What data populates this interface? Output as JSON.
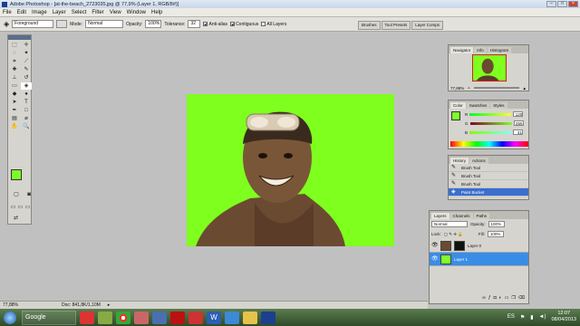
{
  "window": {
    "title": "Adobe Photoshop - [at-the-beach_2723035.jpg @ 77,9% (Layer 1, RGB/8#)]"
  },
  "menu": [
    "File",
    "Edit",
    "Image",
    "Layer",
    "Select",
    "Filter",
    "View",
    "Window",
    "Help"
  ],
  "options": {
    "preset": "Foreground",
    "mode_label": "Mode:",
    "mode_value": "Normal",
    "opacity_label": "Opacity:",
    "opacity_value": "100%",
    "tolerance_label": "Tolerance:",
    "tolerance_value": "32",
    "antialias": "Anti-alias",
    "contiguous": "Contiguous",
    "all_layers": "All Layers"
  },
  "panel_well": [
    "Brushes",
    "Tool Presets",
    "Layer Comps"
  ],
  "navigator": {
    "tabs": [
      "Navigator",
      "Info",
      "Histogram"
    ],
    "zoom": "77,88%"
  },
  "color": {
    "tabs": [
      "Color",
      "Swatches",
      "Styles"
    ],
    "foreground": "#7FFF2A",
    "channels": [
      {
        "label": "R",
        "value": "120",
        "gradient": "linear-gradient(90deg,#00ff2a,#ffff2a)"
      },
      {
        "label": "G",
        "value": "255",
        "gradient": "linear-gradient(90deg,#7f002a,#7fff2a)"
      },
      {
        "label": "B",
        "value": "41",
        "gradient": "linear-gradient(90deg,#7fff00,#7fffff)"
      }
    ]
  },
  "history": {
    "tabs": [
      "History",
      "Actions"
    ],
    "items": [
      {
        "label": "Brush Tool",
        "selected": false
      },
      {
        "label": "Brush Tool",
        "selected": false
      },
      {
        "label": "Brush Tool",
        "selected": false
      },
      {
        "label": "Paint Bucket",
        "selected": true
      }
    ]
  },
  "layers": {
    "tabs": [
      "Layers",
      "Channels",
      "Paths"
    ],
    "blend_mode": "Normal",
    "opacity_label": "Opacity:",
    "opacity_value": "100%",
    "lock_label": "Lock:",
    "fill_label": "Fill:",
    "fill_value": "100%",
    "items": [
      {
        "name": "Layer 0",
        "selected": false
      },
      {
        "name": "Layer 1",
        "selected": true
      }
    ]
  },
  "status": {
    "zoom": "77,88%",
    "doc": "Doc: 841,8K/1,10M"
  },
  "taskbar": {
    "google": "Google",
    "lang": "ES",
    "time": "12:07",
    "date": "08/04/2013"
  }
}
